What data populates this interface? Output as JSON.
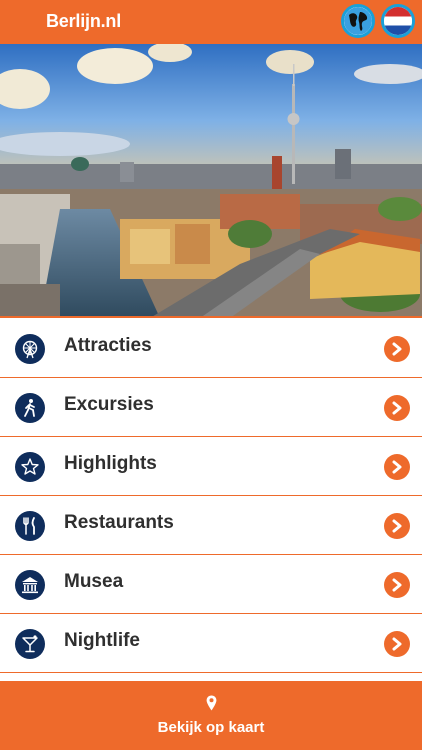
{
  "header": {
    "title": "Berlijn.nl",
    "globe_icon": "globe-icon",
    "language_icon": "dutch-flag-icon"
  },
  "hero": {
    "image": "berlin-skyline-photo"
  },
  "menu": {
    "items": [
      {
        "label": "Attracties",
        "icon": "ferris-wheel-icon"
      },
      {
        "label": "Excursies",
        "icon": "walking-person-icon"
      },
      {
        "label": "Highlights",
        "icon": "star-icon"
      },
      {
        "label": "Restaurants",
        "icon": "fork-knife-icon"
      },
      {
        "label": "Musea",
        "icon": "museum-icon"
      },
      {
        "label": "Nightlife",
        "icon": "cocktail-icon"
      }
    ]
  },
  "footer": {
    "map_label": "Bekijk op kaart",
    "map_icon": "location-pin-icon"
  },
  "colors": {
    "accent": "#ee6a2b",
    "icon_bg": "#0f2d5c",
    "text": "#2f2f2f"
  }
}
